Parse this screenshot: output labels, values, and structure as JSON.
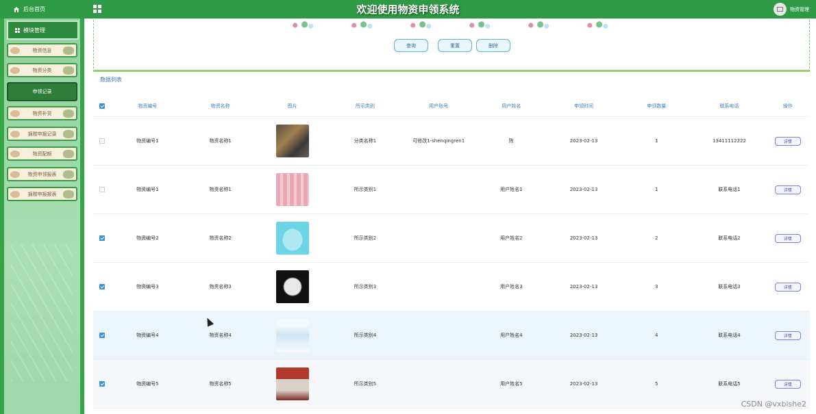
{
  "topbar": {
    "home_label": "后台首页",
    "title": "欢迎使用物资申领系统",
    "user_label": "物资管理"
  },
  "sidebar": {
    "section_label": "模块管理",
    "items": [
      {
        "label": "物资信息",
        "active": false
      },
      {
        "label": "物资分类",
        "active": false
      },
      {
        "label": "申领记录",
        "active": true
      },
      {
        "label": "物资补货",
        "active": false
      },
      {
        "label": "捐赠申报记录",
        "active": false
      },
      {
        "label": "物资配额",
        "active": false
      },
      {
        "label": "物资申领报表",
        "active": false
      },
      {
        "label": "捐赠申报报表",
        "active": false
      }
    ]
  },
  "search": {
    "query_button": "查询",
    "reset_button": "重置",
    "delete_button": "删除"
  },
  "table": {
    "list_label": "数据列表",
    "columns": [
      "物资编号",
      "物资名称",
      "图片",
      "所示类别",
      "用户账号",
      "用户姓名",
      "申领时间",
      "申领数量",
      "联系电话",
      "操作"
    ],
    "rows": [
      {
        "checked": false,
        "code": "物资编号1",
        "name": "物资名称1",
        "category": "分类名称1",
        "account": "可修改1-shenqingren1",
        "username": "陈",
        "time": "2023-02-13",
        "qty": "1",
        "phone": "13411112222",
        "action": "详情",
        "img": "warehouse"
      },
      {
        "checked": false,
        "code": "物资编号1",
        "name": "物资名称1",
        "category": "所示类别1",
        "account": "",
        "username": "用户姓名1",
        "time": "2023-02-13",
        "qty": "1",
        "phone": "联系电话1",
        "action": "详情",
        "img": "boxes"
      },
      {
        "checked": true,
        "code": "物资编号2",
        "name": "物资名称2",
        "category": "所示类别2",
        "account": "",
        "username": "用户姓名2",
        "time": "2023-02-13",
        "qty": "2",
        "phone": "联系电话2",
        "action": "详情",
        "img": "mask-blue"
      },
      {
        "checked": true,
        "code": "物资编号3",
        "name": "物资名称3",
        "category": "所示类别3",
        "account": "",
        "username": "用户姓名3",
        "time": "2023-02-13",
        "qty": "3",
        "phone": "联系电话3",
        "action": "详情",
        "img": "mask-white"
      },
      {
        "checked": true,
        "code": "物资编号4",
        "name": "物资名称4",
        "category": "所示类别4",
        "account": "",
        "username": "用户姓名4",
        "time": "2023-02-13",
        "qty": "4",
        "phone": "联系电话4",
        "action": "详情",
        "img": "suit"
      },
      {
        "checked": true,
        "code": "物资编号5",
        "name": "物资名称5",
        "category": "所示类别5",
        "account": "",
        "username": "用户姓名5",
        "time": "2023-02-13",
        "qty": "5",
        "phone": "联系电话5",
        "action": "详情",
        "img": "store"
      }
    ]
  },
  "watermark": "CSDN @vxbishe2",
  "colors": {
    "primary_green": "#2f9a45",
    "link_blue": "#3d7fc1",
    "checkbox_blue": "#3d8fe0"
  }
}
